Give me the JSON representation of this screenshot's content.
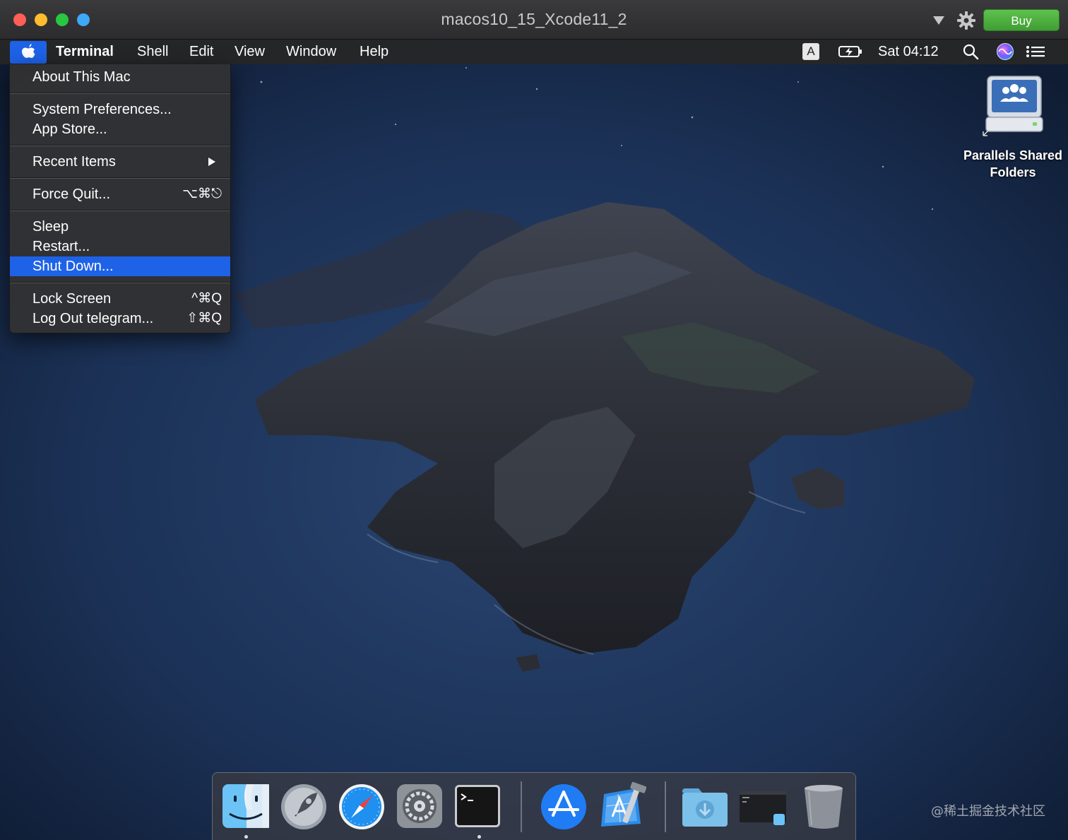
{
  "window": {
    "title": "macos10_15_Xcode11_2",
    "buy_label": "Buy",
    "icons": [
      "window-close",
      "window-minimize",
      "window-zoom",
      "window-extra",
      "dropdown-triangle-icon",
      "gear-icon"
    ]
  },
  "menubar": {
    "apple_icon": "apple-logo-icon",
    "items": [
      "Terminal",
      "Shell",
      "Edit",
      "View",
      "Window",
      "Help"
    ],
    "input_source": "A",
    "status_icons": [
      "battery-charging-icon",
      "spotlight-search-icon",
      "siri-icon",
      "notification-center-icon"
    ],
    "clock": "Sat 04:12"
  },
  "apple_menu": {
    "items": [
      {
        "label": "About This Mac",
        "shortcut": ""
      },
      {
        "label": "System Preferences...",
        "shortcut": ""
      },
      {
        "label": "App Store...",
        "shortcut": ""
      },
      {
        "label": "Recent Items",
        "shortcut": "",
        "submenu": true
      },
      {
        "label": "Force Quit...",
        "shortcut": "⌥⌘⎋"
      },
      {
        "label": "Sleep",
        "shortcut": ""
      },
      {
        "label": "Restart...",
        "shortcut": ""
      },
      {
        "label": "Shut Down...",
        "shortcut": "",
        "highlighted": true
      },
      {
        "label": "Lock Screen",
        "shortcut": "^⌘Q"
      },
      {
        "label": "Log Out telegram...",
        "shortcut": "⇧⌘Q"
      }
    ]
  },
  "desktop": {
    "shared_folder": {
      "line1": "Parallels Shared",
      "line2": "Folders",
      "icon": "shared-drive-icon"
    }
  },
  "dock": {
    "apps": [
      "finder-icon",
      "launchpad-icon",
      "safari-icon",
      "system-preferences-icon",
      "terminal-icon",
      "app-store-icon",
      "xcode-icon",
      "downloads-folder-icon",
      "recent-window-icon",
      "trash-icon"
    ],
    "running": [
      "finder-icon",
      "terminal-icon"
    ]
  },
  "watermark": "@稀土掘金技术社区",
  "colors": {
    "menu_highlight": "#1e62e8",
    "buy_button": "#4caf3f"
  }
}
